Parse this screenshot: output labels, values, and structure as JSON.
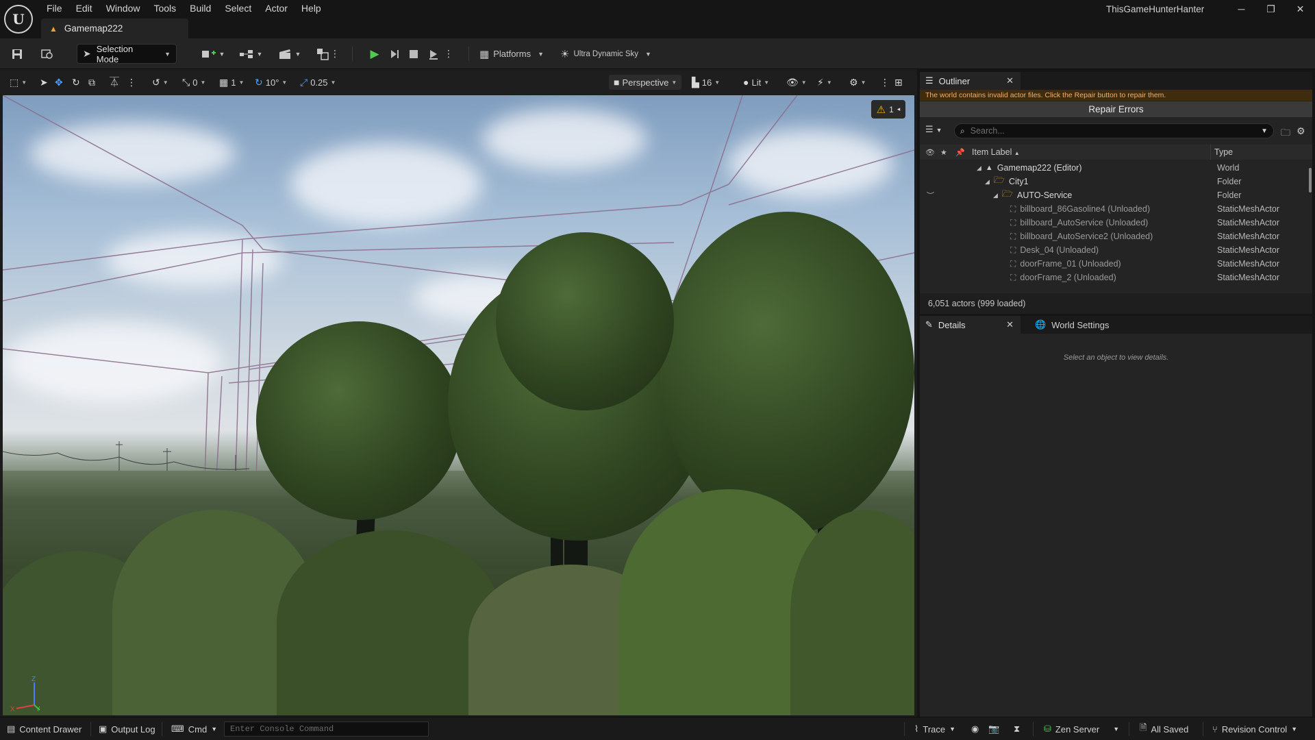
{
  "app": {
    "logo": "unreal-engine-logo",
    "menu": [
      "File",
      "Edit",
      "Window",
      "Tools",
      "Build",
      "Select",
      "Actor",
      "Help"
    ],
    "document_tab": "Gamemap222",
    "project_name": "ThisGameHunterHanter",
    "window_controls": [
      "minimize-icon",
      "restore-icon",
      "close-icon"
    ]
  },
  "toolbar": {
    "mode_label": "Selection Mode",
    "platforms_label": "Platforms",
    "sky_label": "Ultra Dynamic Sky"
  },
  "viewport_toolbar": {
    "rotation_snap_value": "0",
    "grid_value": "1",
    "angle_snap": "10°",
    "scale_snap": "0.25",
    "view_mode": "Perspective",
    "camera_speed": "16",
    "lighting": "Lit"
  },
  "viewport": {
    "warning_count": "1",
    "axis_labels": {
      "x": "X",
      "y": "Y",
      "z": "Z"
    }
  },
  "outliner": {
    "tab_label": "Outliner",
    "warning": "The world contains invalid actor files. Click the Repair button to repair them.",
    "repair_label": "Repair Errors",
    "search_placeholder": "Search...",
    "col_label": "Item Label",
    "col_type": "Type",
    "rows": [
      {
        "name": "Gamemap222 (Editor)",
        "type": "World"
      },
      {
        "name": "City1",
        "type": "Folder"
      },
      {
        "name": "AUTO-Service",
        "type": "Folder"
      },
      {
        "name": "billboard_86Gasoline4 (Unloaded)",
        "type": "StaticMeshActor"
      },
      {
        "name": "billboard_AutoService (Unloaded)",
        "type": "StaticMeshActor"
      },
      {
        "name": "billboard_AutoService2 (Unloaded)",
        "type": "StaticMeshActor"
      },
      {
        "name": "Desk_04 (Unloaded)",
        "type": "StaticMeshActor"
      },
      {
        "name": "doorFrame_01 (Unloaded)",
        "type": "StaticMeshActor"
      },
      {
        "name": "doorFrame_2 (Unloaded)",
        "type": "StaticMeshActor"
      }
    ],
    "footer": "6,051 actors (999 loaded)"
  },
  "details": {
    "tab_label": "Details",
    "world_settings_label": "World Settings",
    "empty_message": "Select an object to view details."
  },
  "statusbar": {
    "content_drawer": "Content Drawer",
    "output_log": "Output Log",
    "cmd": "Cmd",
    "console_placeholder": "Enter Console Command",
    "trace": "Trace",
    "zen_server": "Zen Server",
    "all_saved": "All Saved",
    "revision_control": "Revision Control"
  }
}
